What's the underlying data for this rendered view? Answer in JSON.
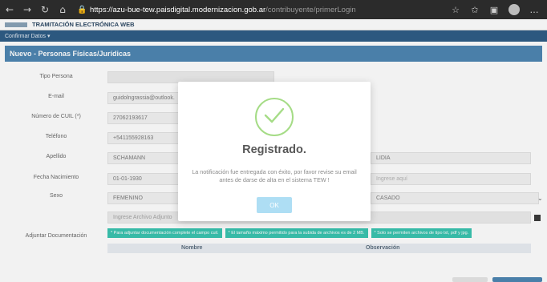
{
  "browser": {
    "url_host": "https://azu-bue-tew.paisdigital.modernizacion.gob.ar",
    "url_path": "/contribuyente/primerLogin"
  },
  "app": {
    "title": "TRAMITACIÓN ELECTRÓNICA WEB",
    "menu_label": "Confirmar Datos",
    "section_title": "Nuevo - Personas Físicas/Jurídicas"
  },
  "form": {
    "tipo_persona_label": "Tipo Persona",
    "email_label": "E-mail",
    "email_value": "guidolngrassia@outlook.",
    "cuil_label": "Número de CUIL (*)",
    "cuil_value": "27062193617",
    "telefono_label": "Teléfono",
    "telefono_value": "+541155928163",
    "apellido_label": "Apellido",
    "apellido_value": "SCHAMANN",
    "nombre_value": "LIDIA",
    "fecha_label": "Fecha Nacimiento",
    "fecha_value": "01-01-1930",
    "extra_placeholder": "Ingrese aquí",
    "sexo_label": "Sexo",
    "sexo_value": "FEMENINO",
    "estado_civil_value": "CASADO",
    "archivo_placeholder": "Ingrese Archivo Adjunto",
    "adjuntar_label": "Adjuntar Documentación"
  },
  "info_chips": [
    "* Para adjuntar documentación complete el campo cuil.",
    "* El tamaño máximo permitido para la subida de archivos es de 2 MB.",
    "* Solo se permiten archivos de tipo txt, pdf y jpg."
  ],
  "table": {
    "col_nombre": "Nombre",
    "col_observacion": "Observación"
  },
  "modal": {
    "title": "Registrado.",
    "message": "La notificación fue entregada con éxito, por favor revise su email antes de darse de alta en el sistema TEW !",
    "ok_label": "OK"
  },
  "colors": {
    "menu_bar": "#2f5d86",
    "section_bar": "#4f86b3",
    "chip": "#3ac4b0",
    "ok_button": "#aedef4",
    "success_green": "#a5dc86"
  }
}
